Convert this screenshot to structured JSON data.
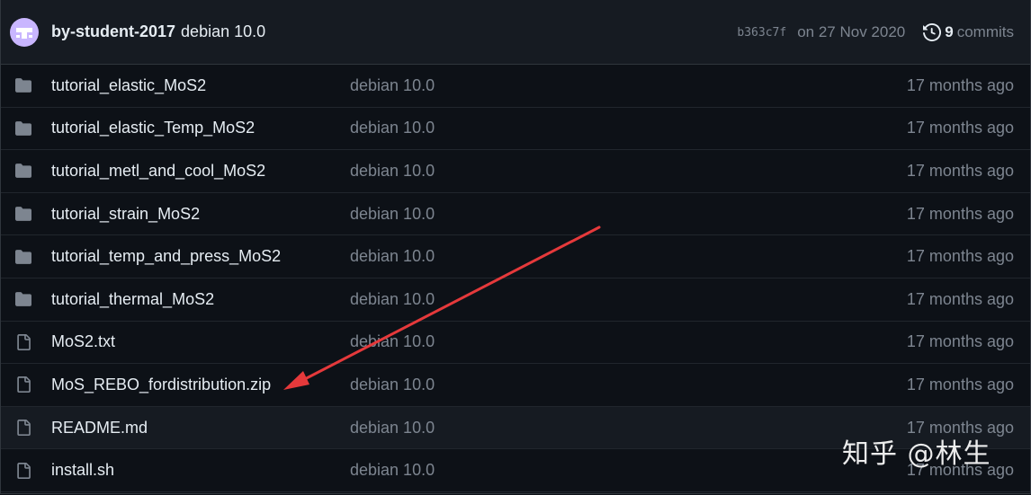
{
  "header": {
    "author": "by-student-2017",
    "message": "debian 10.0",
    "sha": "b363c7f",
    "date": "on 27 Nov 2020",
    "commits_count": "9",
    "commits_label": "commits"
  },
  "files": [
    {
      "name": "tutorial_elastic_MoS2",
      "type": "folder",
      "message": "debian 10.0",
      "age": "17 months ago"
    },
    {
      "name": "tutorial_elastic_Temp_MoS2",
      "type": "folder",
      "message": "debian 10.0",
      "age": "17 months ago"
    },
    {
      "name": "tutorial_metl_and_cool_MoS2",
      "type": "folder",
      "message": "debian 10.0",
      "age": "17 months ago"
    },
    {
      "name": "tutorial_strain_MoS2",
      "type": "folder",
      "message": "debian 10.0",
      "age": "17 months ago"
    },
    {
      "name": "tutorial_temp_and_press_MoS2",
      "type": "folder",
      "message": "debian 10.0",
      "age": "17 months ago"
    },
    {
      "name": "tutorial_thermal_MoS2",
      "type": "folder",
      "message": "debian 10.0",
      "age": "17 months ago"
    },
    {
      "name": "MoS2.txt",
      "type": "file",
      "message": "debian 10.0",
      "age": "17 months ago"
    },
    {
      "name": "MoS_REBO_fordistribution.zip",
      "type": "file",
      "message": "debian 10.0",
      "age": "17 months ago"
    },
    {
      "name": "README.md",
      "type": "file",
      "message": "debian 10.0",
      "age": "17 months ago"
    },
    {
      "name": "install.sh",
      "type": "file",
      "message": "debian 10.0",
      "age": "17 months ago"
    }
  ],
  "watermark": "知乎 @林生",
  "colors": {
    "background": "#0d1117",
    "header_bg": "#161b22",
    "text_primary": "#e6edf3",
    "text_muted": "#7d8590",
    "icon_color": "#7d8590",
    "arrow": "#e5393b"
  },
  "icons": {
    "folder": "folder-icon",
    "file": "file-icon",
    "history": "history-icon"
  }
}
